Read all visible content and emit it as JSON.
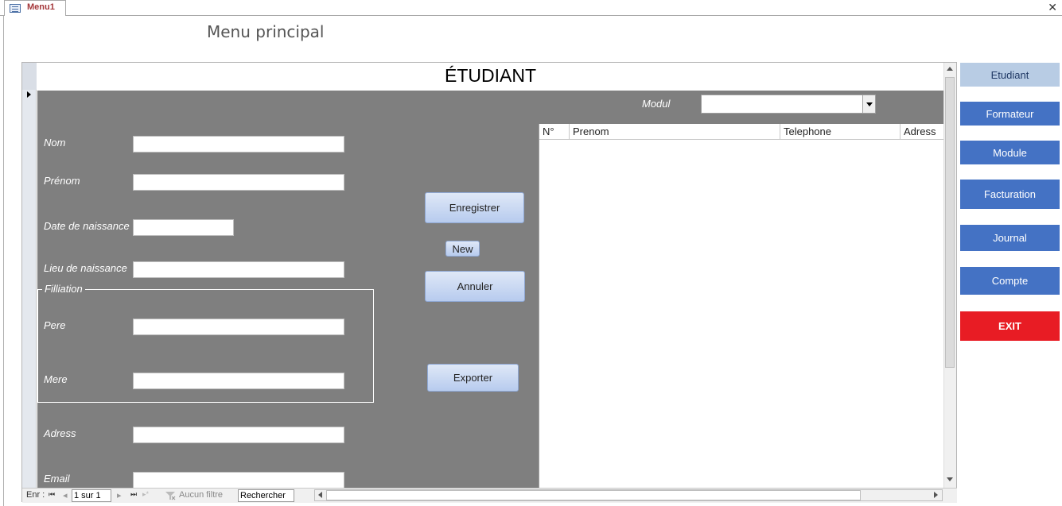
{
  "window": {
    "tab_label": "Menu1",
    "close_glyph": "✕"
  },
  "page_title": "Menu principal",
  "form": {
    "title": "ÉTUDIANT",
    "modul_label": "Modul",
    "modul_value": "",
    "fields": {
      "nom": {
        "label": "Nom",
        "value": ""
      },
      "prenom": {
        "label": "Prénom",
        "value": ""
      },
      "date_naissance": {
        "label": "Date de naissance",
        "value": ""
      },
      "lieu_naissance": {
        "label": "Lieu de naissance",
        "value": ""
      },
      "filliation_label": "Filliation",
      "pere": {
        "label": "Pere",
        "value": ""
      },
      "mere": {
        "label": "Mere",
        "value": ""
      },
      "adress": {
        "label": "Adress",
        "value": ""
      },
      "email": {
        "label": "Email",
        "value": ""
      }
    },
    "buttons": {
      "enregistrer": "Enregistrer",
      "new": "New",
      "annuler": "Annuler",
      "exporter": "Exporter"
    },
    "list": {
      "columns": [
        "N°",
        "Prenom",
        "Telephone",
        "Adress"
      ],
      "rows": []
    }
  },
  "record_nav": {
    "label": "Enr :",
    "first_glyph": "⏮",
    "prev_glyph": "◂",
    "position": "1 sur 1",
    "next_glyph": "▸",
    "last_glyph": "⏭",
    "new_glyph": "▸*",
    "filter_label": "Aucun filtre",
    "search_placeholder": "Rechercher"
  },
  "side_nav": {
    "items": [
      {
        "label": "Etudiant",
        "color": "#b8cce4",
        "text_color": "#1f3864",
        "selected": true
      },
      {
        "label": "Formateur",
        "color": "#4472c4",
        "text_color": "#ffffff"
      },
      {
        "label": "Module",
        "color": "#4472c4",
        "text_color": "#ffffff"
      },
      {
        "label": "Facturation",
        "color": "#4472c4",
        "text_color": "#ffffff"
      },
      {
        "label": "Journal",
        "color": "#4472c4",
        "text_color": "#ffffff"
      },
      {
        "label": "Compte",
        "color": "#4472c4",
        "text_color": "#ffffff"
      },
      {
        "label": "EXIT",
        "color": "#e81c24",
        "text_color": "#ffffff"
      }
    ]
  },
  "colors": {
    "detail_bg": "#7f7f7f",
    "accent_blue": "#4472c4",
    "exit_red": "#e81c24",
    "tab_text": "#a4373a"
  }
}
